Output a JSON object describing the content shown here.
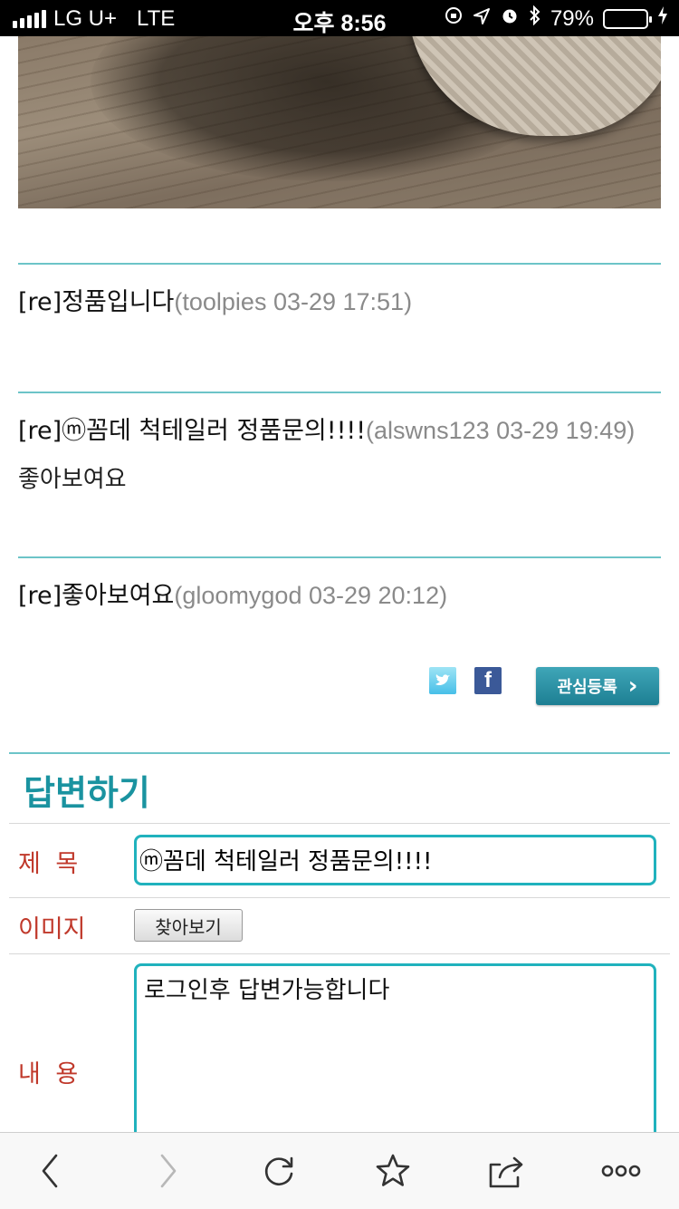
{
  "status_bar": {
    "carrier": "LG U+",
    "network": "LTE",
    "time": "오후 8:56",
    "battery": "79%",
    "battery_level": 0.79,
    "icons": [
      "orientation-lock-icon",
      "location-icon",
      "alarm-icon",
      "bluetooth-icon",
      "charging-icon"
    ]
  },
  "comments": [
    {
      "title": "[re]정품입니다",
      "meta": "(toolpies 03-29 17:51)",
      "body": ""
    },
    {
      "title": "[re]ⓜ꼼데 척테일러 정품문의!!!!",
      "meta": "(alswns123 03-29 19:49)",
      "body": "좋아보여요"
    },
    {
      "title": "[re]좋아보여요",
      "meta": "(gloomygod 03-29 20:12)",
      "body": ""
    }
  ],
  "social": {
    "favorite_label": "관심등록",
    "favorite_arrow": "›"
  },
  "reply": {
    "heading": "답변하기",
    "title_label": "제 목",
    "title_value": "ⓜ꼼데 척테일러 정품문의!!!!",
    "image_label": "이미지",
    "browse_label": "찾아보기",
    "content_label": "내 용",
    "content_value": "로그인후 답변가능합니다"
  },
  "toolbar": {
    "icons": [
      "back-icon",
      "forward-icon",
      "reload-icon",
      "bookmark-star-icon",
      "share-icon",
      "more-icon"
    ]
  },
  "colors": {
    "accent": "#20b2bd",
    "divider": "#6cc4c8",
    "label": "#c0392b",
    "heading": "#1a93a0"
  }
}
